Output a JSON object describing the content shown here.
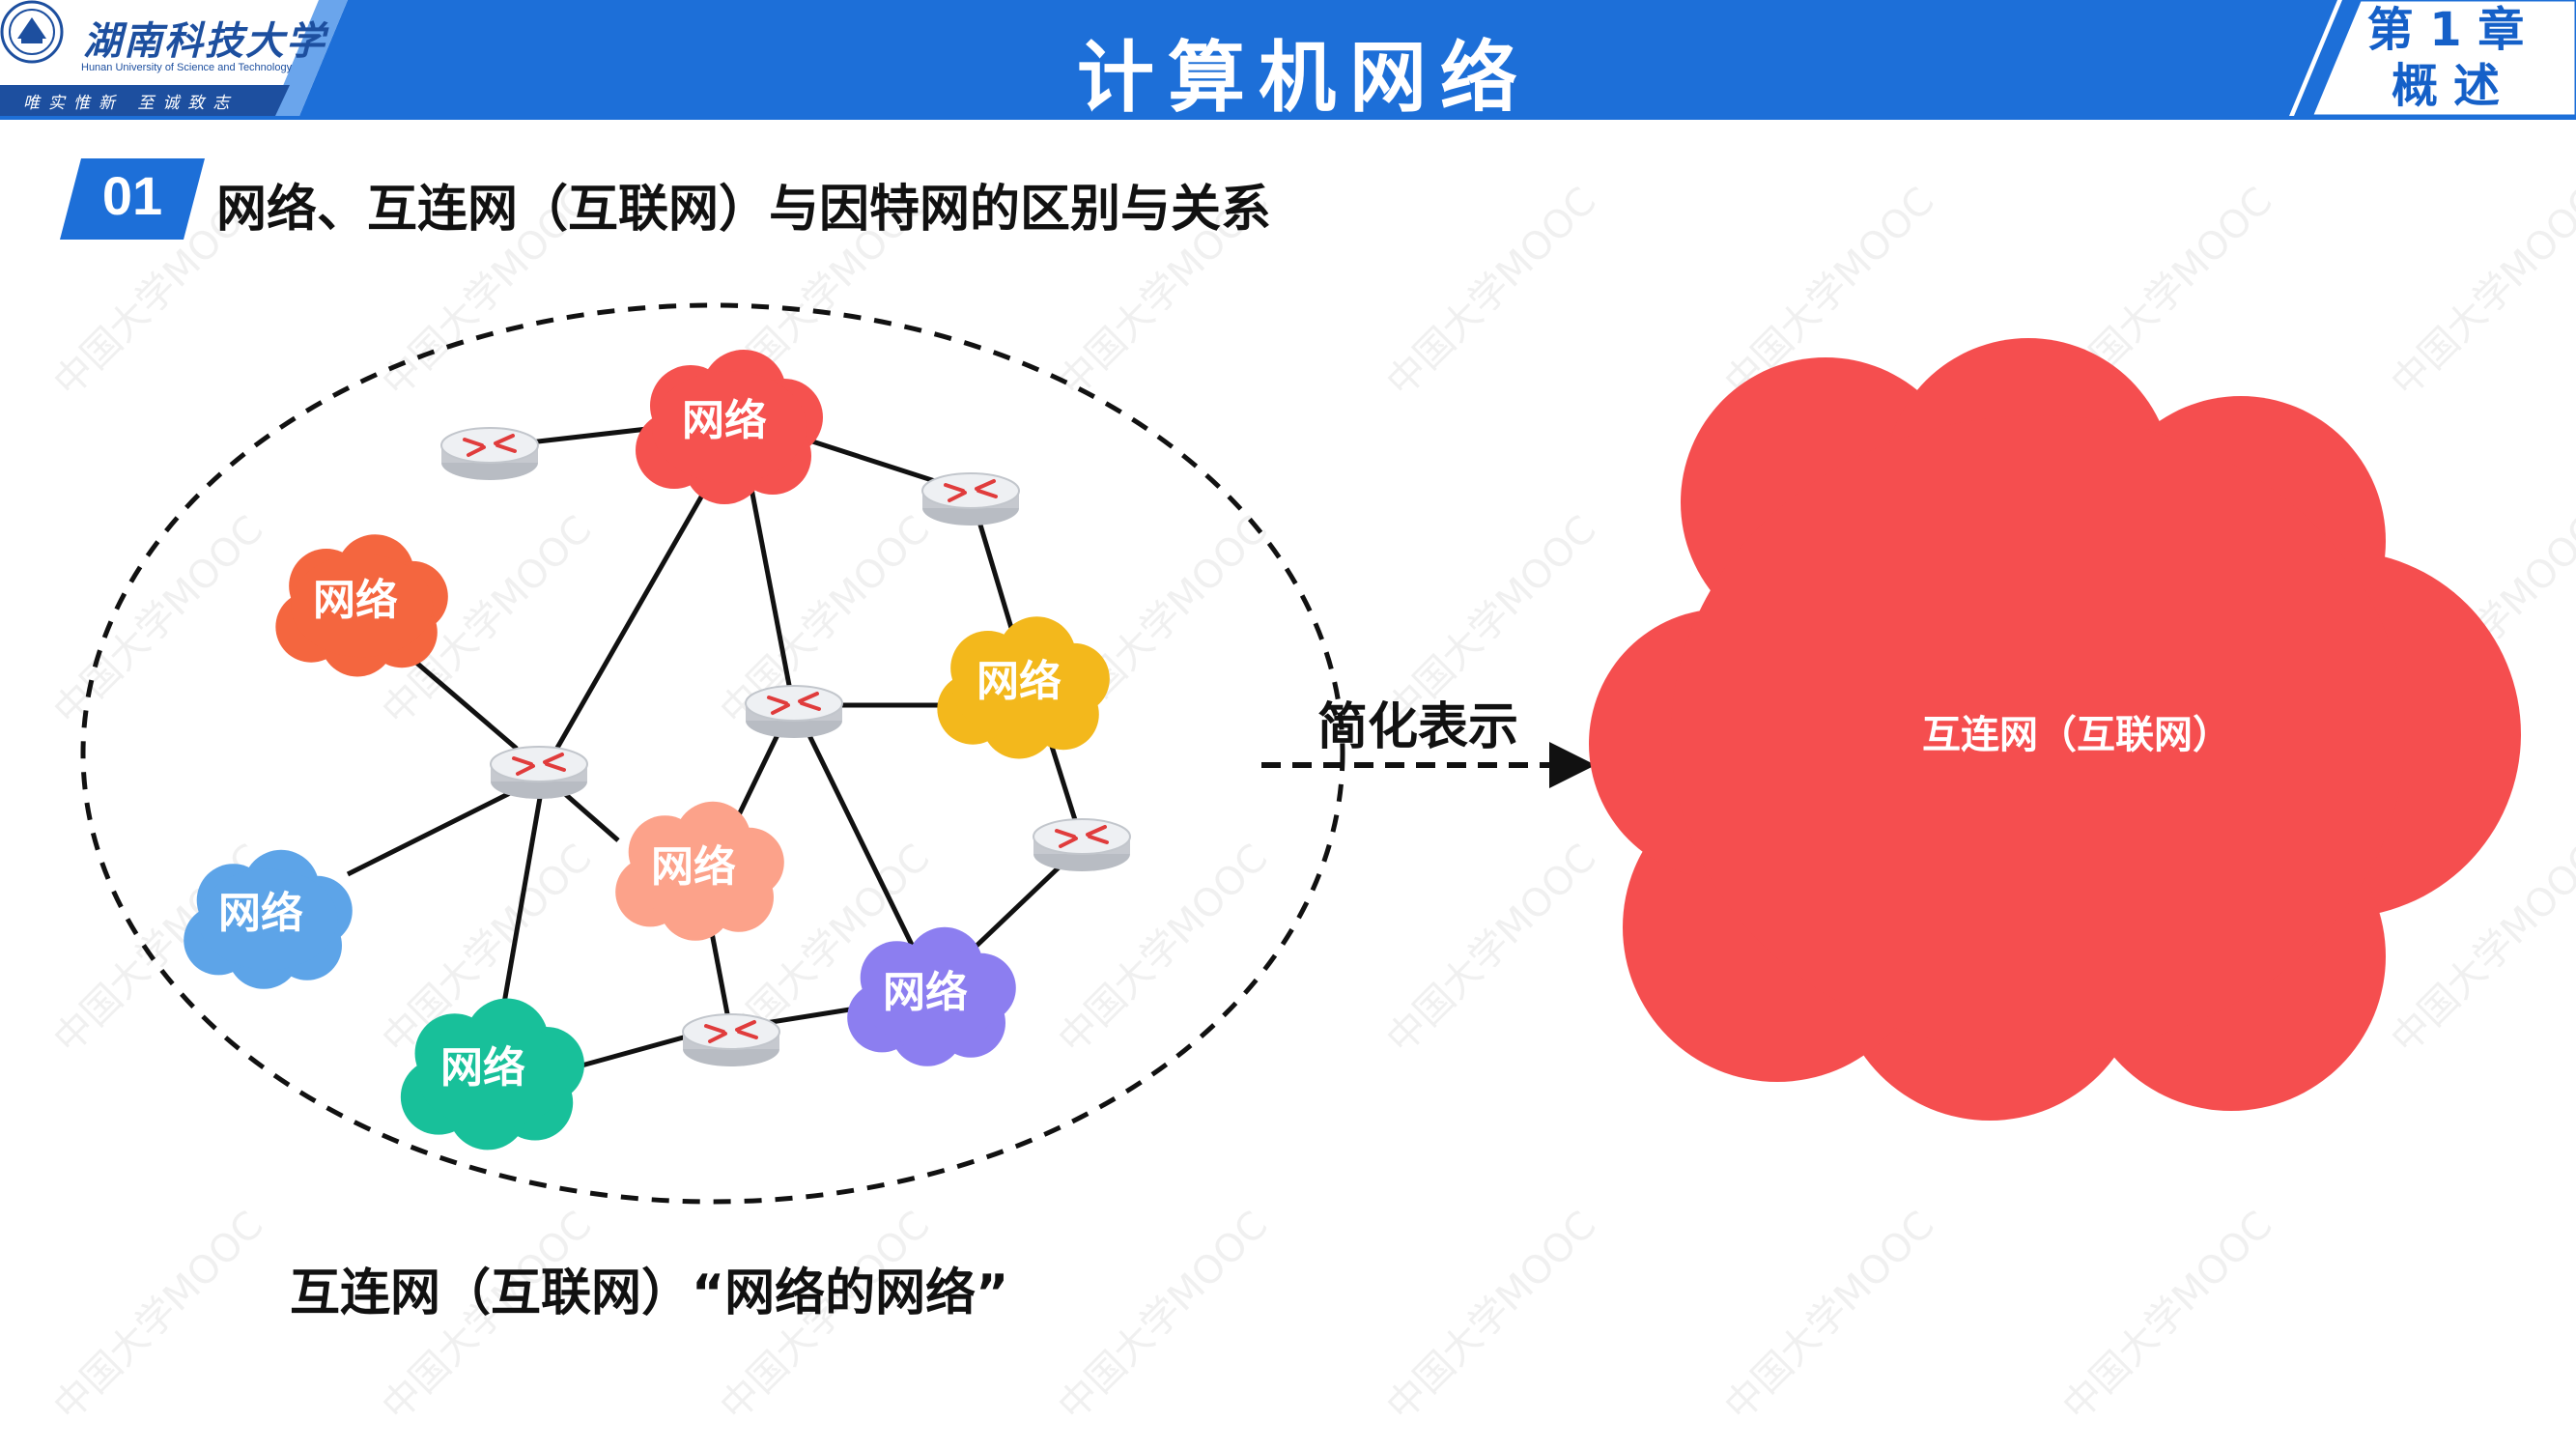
{
  "header": {
    "university_name": "湖南科技大学",
    "university_name_en": "Hunan University of Science and Technology",
    "university_motto": "唯实惟新 至诚致志",
    "title": "计算机网络",
    "chapter_line1": "第 1 章",
    "chapter_line2": "概述"
  },
  "section": {
    "number": "01",
    "title": "网络、互连网（互联网）与因特网的区别与关系"
  },
  "diagram": {
    "network_label": "网络",
    "networks": [
      {
        "label": "网络",
        "color": "#f5524f"
      },
      {
        "label": "网络",
        "color": "#f4663f"
      },
      {
        "label": "网络",
        "color": "#f3b81c"
      },
      {
        "label": "网络",
        "color": "#fca28a"
      },
      {
        "label": "网络",
        "color": "#5da4e8"
      },
      {
        "label": "网络",
        "color": "#8c7ef0"
      },
      {
        "label": "网络",
        "color": "#18c09a"
      }
    ],
    "router_icon": "router-icon",
    "caption": "互连网（互联网）“网络的网络”",
    "arrow_label": "简化表示",
    "internet_label": "互连网（互联网）",
    "internet_color": "#f54e4f"
  },
  "colors": {
    "header_blue": "#1d6fd8",
    "accent_blue": "#1560c8"
  },
  "watermark": "中国大学MOOC"
}
